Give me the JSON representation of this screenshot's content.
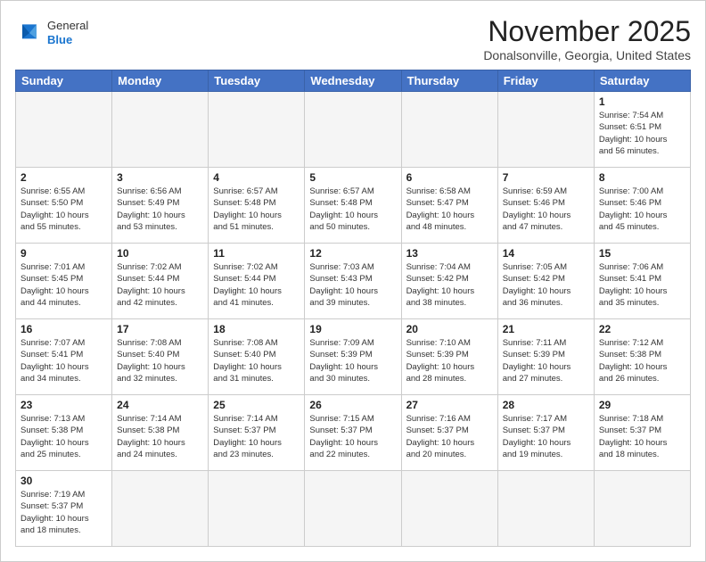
{
  "header": {
    "logo": {
      "general": "General",
      "blue": "Blue"
    },
    "title": "November 2025",
    "location": "Donalsonville, Georgia, United States"
  },
  "weekdays": [
    "Sunday",
    "Monday",
    "Tuesday",
    "Wednesday",
    "Thursday",
    "Friday",
    "Saturday"
  ],
  "weeks": [
    [
      {
        "day": "",
        "info": ""
      },
      {
        "day": "",
        "info": ""
      },
      {
        "day": "",
        "info": ""
      },
      {
        "day": "",
        "info": ""
      },
      {
        "day": "",
        "info": ""
      },
      {
        "day": "",
        "info": ""
      },
      {
        "day": "1",
        "info": "Sunrise: 7:54 AM\nSunset: 6:51 PM\nDaylight: 10 hours\nand 56 minutes."
      }
    ],
    [
      {
        "day": "2",
        "info": "Sunrise: 6:55 AM\nSunset: 5:50 PM\nDaylight: 10 hours\nand 55 minutes."
      },
      {
        "day": "3",
        "info": "Sunrise: 6:56 AM\nSunset: 5:49 PM\nDaylight: 10 hours\nand 53 minutes."
      },
      {
        "day": "4",
        "info": "Sunrise: 6:57 AM\nSunset: 5:48 PM\nDaylight: 10 hours\nand 51 minutes."
      },
      {
        "day": "5",
        "info": "Sunrise: 6:57 AM\nSunset: 5:48 PM\nDaylight: 10 hours\nand 50 minutes."
      },
      {
        "day": "6",
        "info": "Sunrise: 6:58 AM\nSunset: 5:47 PM\nDaylight: 10 hours\nand 48 minutes."
      },
      {
        "day": "7",
        "info": "Sunrise: 6:59 AM\nSunset: 5:46 PM\nDaylight: 10 hours\nand 47 minutes."
      },
      {
        "day": "8",
        "info": "Sunrise: 7:00 AM\nSunset: 5:46 PM\nDaylight: 10 hours\nand 45 minutes."
      }
    ],
    [
      {
        "day": "9",
        "info": "Sunrise: 7:01 AM\nSunset: 5:45 PM\nDaylight: 10 hours\nand 44 minutes."
      },
      {
        "day": "10",
        "info": "Sunrise: 7:02 AM\nSunset: 5:44 PM\nDaylight: 10 hours\nand 42 minutes."
      },
      {
        "day": "11",
        "info": "Sunrise: 7:02 AM\nSunset: 5:44 PM\nDaylight: 10 hours\nand 41 minutes."
      },
      {
        "day": "12",
        "info": "Sunrise: 7:03 AM\nSunset: 5:43 PM\nDaylight: 10 hours\nand 39 minutes."
      },
      {
        "day": "13",
        "info": "Sunrise: 7:04 AM\nSunset: 5:42 PM\nDaylight: 10 hours\nand 38 minutes."
      },
      {
        "day": "14",
        "info": "Sunrise: 7:05 AM\nSunset: 5:42 PM\nDaylight: 10 hours\nand 36 minutes."
      },
      {
        "day": "15",
        "info": "Sunrise: 7:06 AM\nSunset: 5:41 PM\nDaylight: 10 hours\nand 35 minutes."
      }
    ],
    [
      {
        "day": "16",
        "info": "Sunrise: 7:07 AM\nSunset: 5:41 PM\nDaylight: 10 hours\nand 34 minutes."
      },
      {
        "day": "17",
        "info": "Sunrise: 7:08 AM\nSunset: 5:40 PM\nDaylight: 10 hours\nand 32 minutes."
      },
      {
        "day": "18",
        "info": "Sunrise: 7:08 AM\nSunset: 5:40 PM\nDaylight: 10 hours\nand 31 minutes."
      },
      {
        "day": "19",
        "info": "Sunrise: 7:09 AM\nSunset: 5:39 PM\nDaylight: 10 hours\nand 30 minutes."
      },
      {
        "day": "20",
        "info": "Sunrise: 7:10 AM\nSunset: 5:39 PM\nDaylight: 10 hours\nand 28 minutes."
      },
      {
        "day": "21",
        "info": "Sunrise: 7:11 AM\nSunset: 5:39 PM\nDaylight: 10 hours\nand 27 minutes."
      },
      {
        "day": "22",
        "info": "Sunrise: 7:12 AM\nSunset: 5:38 PM\nDaylight: 10 hours\nand 26 minutes."
      }
    ],
    [
      {
        "day": "23",
        "info": "Sunrise: 7:13 AM\nSunset: 5:38 PM\nDaylight: 10 hours\nand 25 minutes."
      },
      {
        "day": "24",
        "info": "Sunrise: 7:14 AM\nSunset: 5:38 PM\nDaylight: 10 hours\nand 24 minutes."
      },
      {
        "day": "25",
        "info": "Sunrise: 7:14 AM\nSunset: 5:37 PM\nDaylight: 10 hours\nand 23 minutes."
      },
      {
        "day": "26",
        "info": "Sunrise: 7:15 AM\nSunset: 5:37 PM\nDaylight: 10 hours\nand 22 minutes."
      },
      {
        "day": "27",
        "info": "Sunrise: 7:16 AM\nSunset: 5:37 PM\nDaylight: 10 hours\nand 20 minutes."
      },
      {
        "day": "28",
        "info": "Sunrise: 7:17 AM\nSunset: 5:37 PM\nDaylight: 10 hours\nand 19 minutes."
      },
      {
        "day": "29",
        "info": "Sunrise: 7:18 AM\nSunset: 5:37 PM\nDaylight: 10 hours\nand 18 minutes."
      }
    ],
    [
      {
        "day": "30",
        "info": "Sunrise: 7:19 AM\nSunset: 5:37 PM\nDaylight: 10 hours\nand 18 minutes."
      },
      {
        "day": "",
        "info": ""
      },
      {
        "day": "",
        "info": ""
      },
      {
        "day": "",
        "info": ""
      },
      {
        "day": "",
        "info": ""
      },
      {
        "day": "",
        "info": ""
      },
      {
        "day": "",
        "info": ""
      }
    ]
  ]
}
